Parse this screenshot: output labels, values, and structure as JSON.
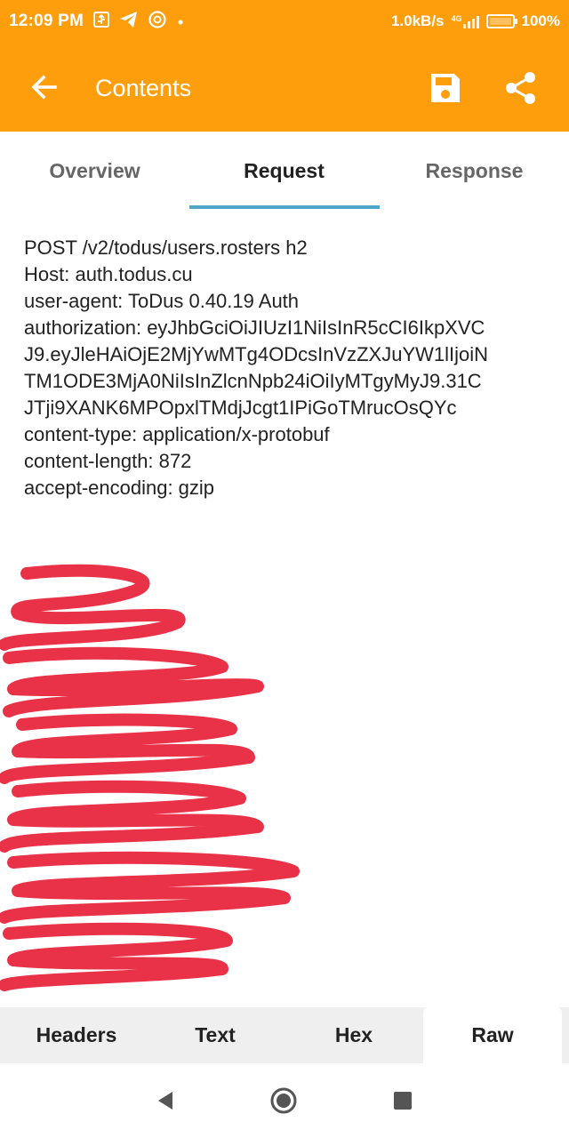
{
  "status_bar": {
    "time": "12:09 PM",
    "net_speed": "1.0kB/s",
    "network_type": "4G",
    "battery": "100%",
    "icons": [
      "usb-icon",
      "telegram-icon",
      "app-notification-icon",
      "dot-icon",
      "signal-icon",
      "battery-charging-icon"
    ]
  },
  "app_bar": {
    "title": "Contents",
    "back_icon": "arrow-left-icon",
    "save_icon": "save-icon",
    "share_icon": "share-icon",
    "color": "#FF9E0D"
  },
  "tabs": {
    "items": [
      {
        "label": "Overview"
      },
      {
        "label": "Request"
      },
      {
        "label": "Response"
      }
    ],
    "active": "Request",
    "indicator_color": "#4EA6C9"
  },
  "request": {
    "lines": [
      "POST /v2/todus/users.rosters h2",
      "Host: auth.todus.cu",
      "user-agent: ToDus 0.40.19 Auth",
      "authorization: eyJhbGciOiJIUzI1NiIsInR5cCI6IkpXVC",
      "J9.eyJleHAiOjE2MjYwMTg4ODcsInVzZXJuYW1lIjoiN",
      "TM1ODE3MjA0NiIsInZlcnNpb24iOiIyMTgyMyJ9.31C",
      "JTji9XANK6MPOpxlTMdjJcgt1IPiGoTMrucOsQYc",
      "content-type: application/x-protobuf",
      "content-length: 872",
      "accept-encoding: gzip"
    ],
    "redacted_note": "body redacted with red scribbles"
  },
  "bottom_tabs": {
    "items": [
      {
        "label": "Headers"
      },
      {
        "label": "Text"
      },
      {
        "label": "Hex"
      },
      {
        "label": "Raw"
      }
    ],
    "active": "Raw"
  },
  "nav_bar": {
    "back_icon": "nav-back-icon",
    "home_icon": "nav-home-icon",
    "recents_icon": "nav-recents-icon"
  }
}
